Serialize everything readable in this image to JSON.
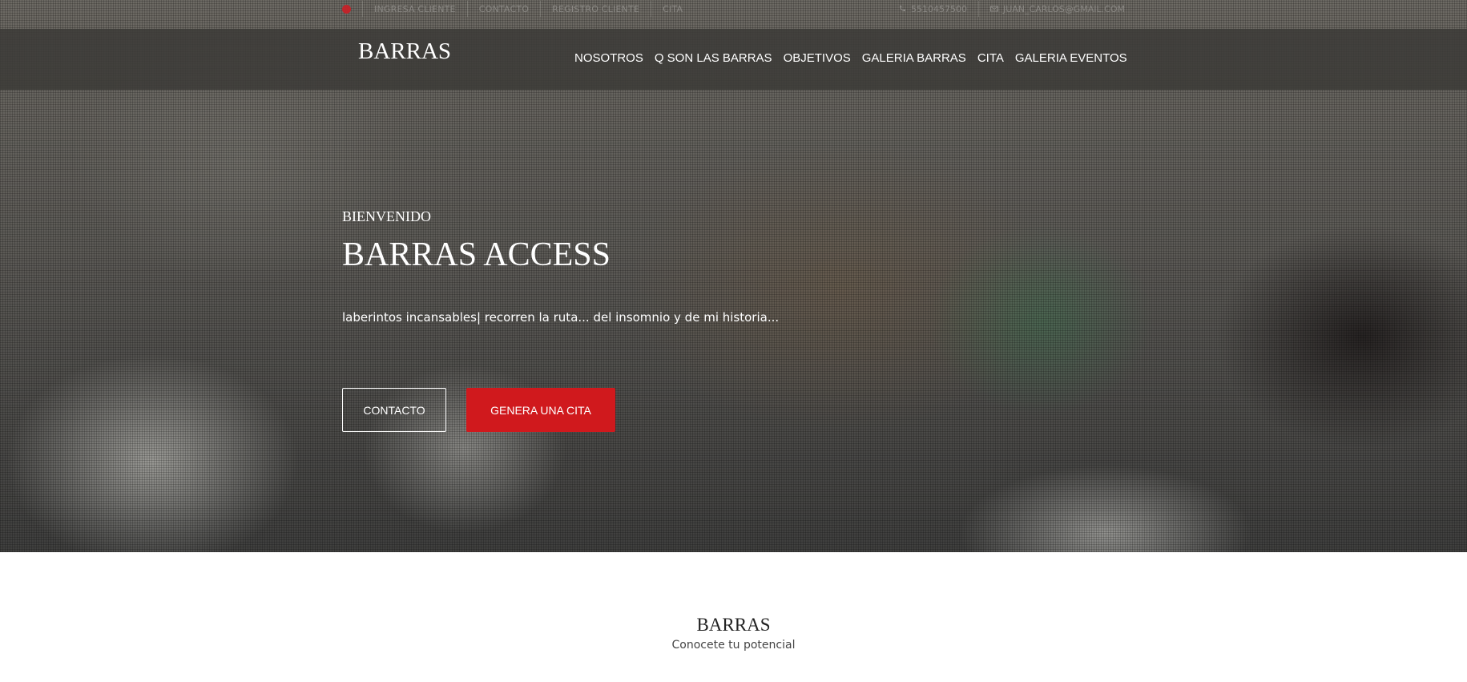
{
  "topbar": {
    "links": [
      "INGRESA CLIENTE",
      "CONTACTO",
      "REGISTRO CLIENTE",
      "CITA"
    ],
    "phone": "5510457500",
    "email": "JUAN_CARLOS@GMAIL.COM"
  },
  "navbar": {
    "logo": "BARRAS",
    "items": [
      "NOSOTROS",
      "Q SON LAS BARRAS",
      "OBJETIVOS",
      "GALERIA BARRAS",
      "CITA",
      "GALERIA EVENTOS"
    ]
  },
  "hero": {
    "welcome": "BIENVENIDO",
    "title": "BARRAS ACCESS",
    "tagline": "laberintos incansables| recorren la ruta... del insomnio y de mi historia...",
    "button_contact": "CONTACTO",
    "button_appointment": "GENERA UNA CITA"
  },
  "section": {
    "title": "BARRAS",
    "subtitle": "Conocete tu potencial"
  },
  "colors": {
    "accent": "#d0191d",
    "navbar_bg": "#3c3b38",
    "text_light": "#ffffff"
  }
}
